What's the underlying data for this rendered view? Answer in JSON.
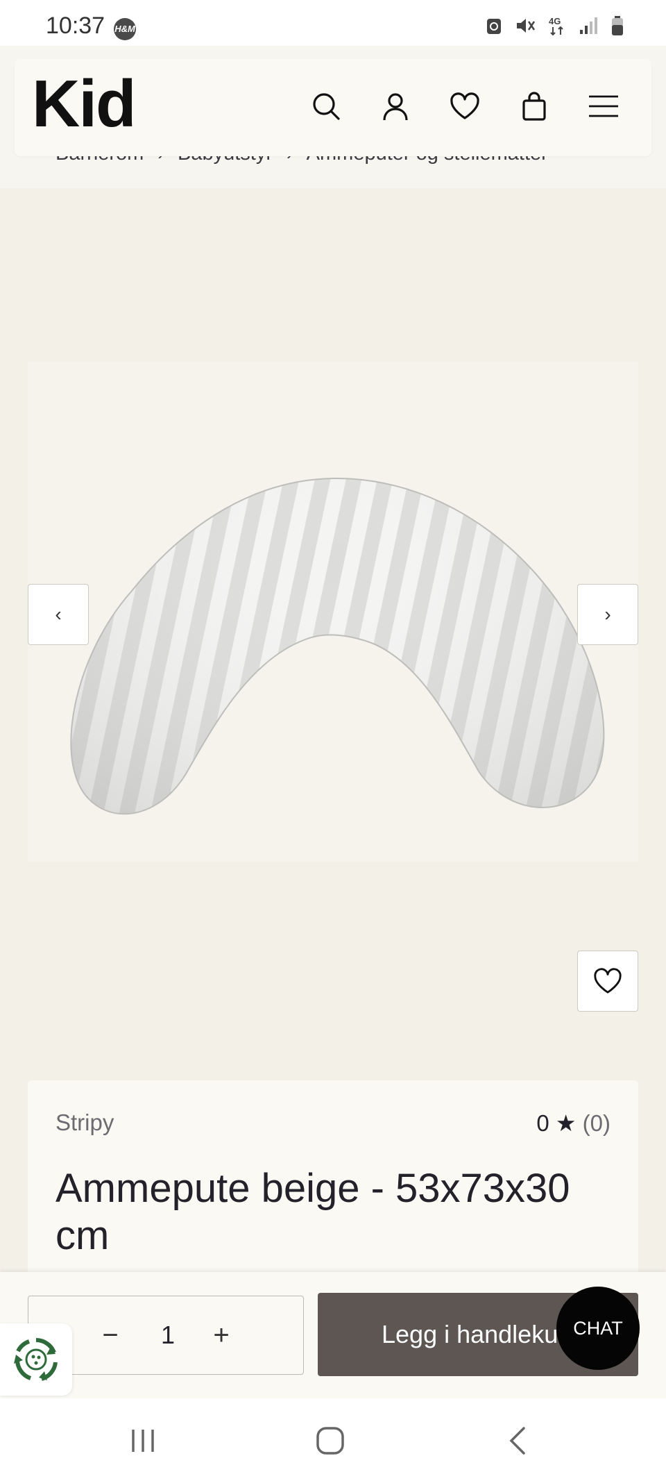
{
  "status_bar": {
    "time": "10:37",
    "app_icon_text": "H&M"
  },
  "header": {
    "logo": "Kid",
    "icons": [
      "search-icon",
      "account-icon",
      "wishlist-icon",
      "cart-icon",
      "menu-icon"
    ]
  },
  "breadcrumb": {
    "items": [
      "Barnerom",
      "Babyutstyr",
      "Ammeputer og stellematter"
    ],
    "separator": "›"
  },
  "gallery": {
    "prev_label": "‹",
    "next_label": "›"
  },
  "product": {
    "brand": "Stripy",
    "rating_value": "0",
    "rating_star": "★",
    "rating_count": "(0)",
    "title": "Ammepute beige - 53x73x30 cm"
  },
  "cart_bar": {
    "decrement": "−",
    "quantity": "1",
    "increment": "+",
    "add_to_cart": "Legg i handlekurv",
    "chat": "CHAT"
  },
  "colors": {
    "page_bg": "#f3f0e8",
    "header_bg": "#faf9f3",
    "add_to_cart_bg": "#5d5653",
    "chat_bg": "#050505",
    "text": "#232129",
    "muted": "#6e6b70"
  }
}
